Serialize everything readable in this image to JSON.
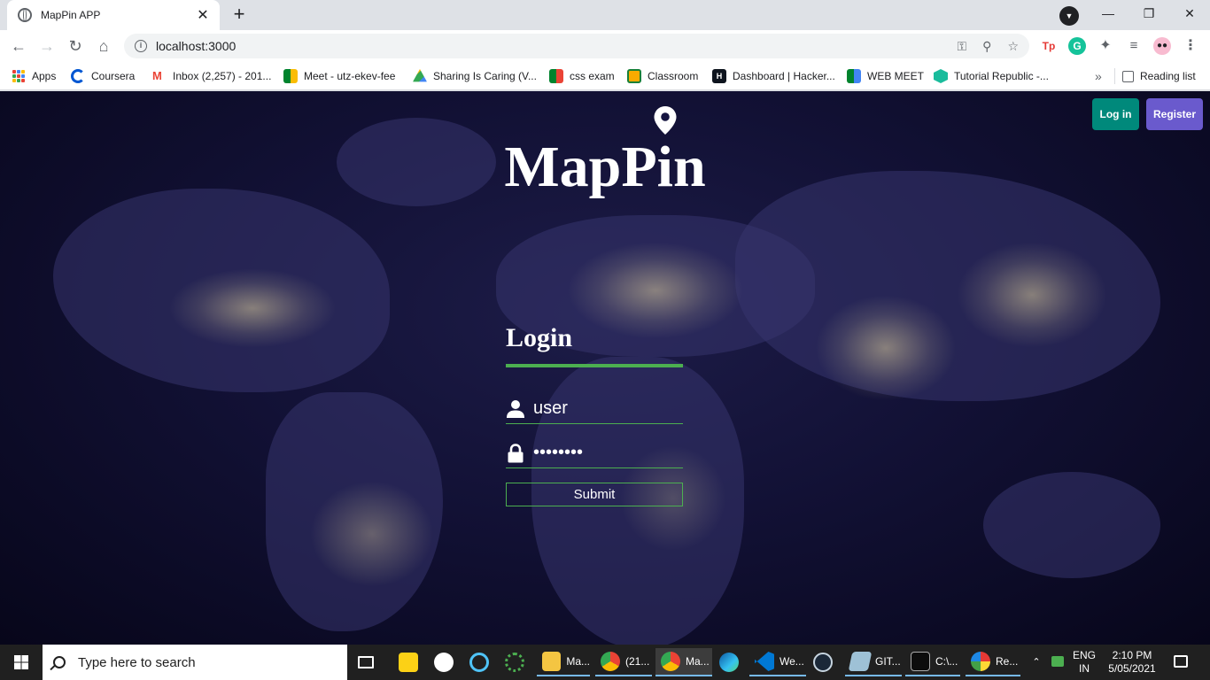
{
  "browser": {
    "tab_title": "MapPin APP",
    "tab_close": "✕",
    "new_tab": "+",
    "url": "localhost:3000",
    "bookmarks": [
      {
        "label": "Apps"
      },
      {
        "label": "Coursera"
      },
      {
        "label": "Inbox (2,257) - 201..."
      },
      {
        "label": "Meet - utz-ekev-fee"
      },
      {
        "label": "Sharing Is Caring (V..."
      },
      {
        "label": "css exam"
      },
      {
        "label": "Classroom"
      },
      {
        "label": "Dashboard | Hacker..."
      },
      {
        "label": "WEB MEET"
      },
      {
        "label": "Tutorial Republic -..."
      }
    ],
    "more_bookmarks": "»",
    "reading_list": "Reading list",
    "ext_tp": "Tp",
    "ext_g": "G"
  },
  "page": {
    "brand": "MapPin",
    "login_button": "Log in",
    "register_button": "Register",
    "login_title": "Login",
    "username_value": "user",
    "password_value": "password",
    "submit_label": "Submit",
    "colors": {
      "login_btn": "#00897b",
      "register_btn": "#6a5acd",
      "accent_green": "#4caf50"
    }
  },
  "taskbar": {
    "search_placeholder": "Type here to search",
    "items": [
      {
        "label": "Ma..."
      },
      {
        "label": "(21..."
      },
      {
        "label": "Ma..."
      },
      {
        "label": "We..."
      },
      {
        "label": "GIT..."
      },
      {
        "label": "C:\\..."
      },
      {
        "label": "Re..."
      }
    ],
    "lang_top": "ENG",
    "lang_bottom": "IN",
    "time": "2:10 PM",
    "date": "5/05/2021"
  }
}
